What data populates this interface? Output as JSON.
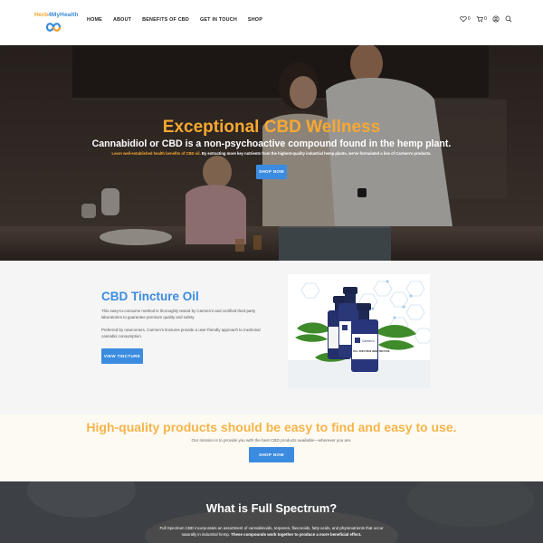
{
  "header": {
    "logo_text_orange": "Herb",
    "logo_text_blue": "4MyHealth",
    "nav": [
      "HOME",
      "ABOUT",
      "BENEFITS OF CBD",
      "GET IN TOUCH",
      "SHOP"
    ],
    "wishlist_count": "0",
    "cart_count": "0"
  },
  "hero": {
    "title": "Exceptional CBD Wellness",
    "subtitle": "Cannabidiol or CBD is a non-psychoactive compound found in the hemp plant.",
    "small_highlight": "Learn well-established health benefits of CBD oil.",
    "small_text": " By extracting more key nutrients from the highest-quality industrial hemp plants, we've formulated a line of Carmen's products.",
    "button": "SHOP NOW"
  },
  "tincture": {
    "title": "CBD Tincture Oil",
    "p1": "This easy-to-consume method is thoroughly tested by Carmen's and certified third-party laboratories to guarantee premium quality and safety.",
    "p2": "Preferred by newcomers, Carmen's tinctures provide a user-friendly approach to medicinal cannabis consumption.",
    "button": "VIEW TINCTURE",
    "bottle_brand": "Carmen's",
    "bottle_label": "FULL SPECTRUM HEMP TINCTURE"
  },
  "mission": {
    "title": "High-quality products should be easy to find and easy to use.",
    "subtitle": "Our mission is to provide you with the best CBD products available—wherever you are.",
    "button": "SHOP NOW"
  },
  "spectrum": {
    "title": "What is Full Spectrum?",
    "p_line1": "Full Spectrum CBD incorporates an assortment of cannabinoids, terpenes, flavonoids, fatty acids, and phytonutrients that occur",
    "p_line2a": "naturally in industrial hemp. ",
    "p_line2b": "These compounds work together to produce a more beneficial effect."
  },
  "colors": {
    "accent_blue": "#3b8be0",
    "accent_orange": "#f8a832"
  },
  "icons": [
    "heart-icon",
    "cart-icon",
    "user-icon",
    "search-icon"
  ]
}
